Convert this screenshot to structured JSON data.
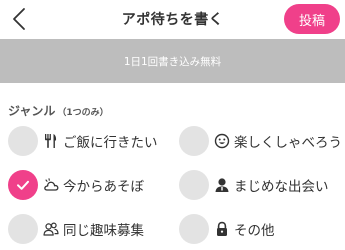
{
  "header": {
    "title": "アポ待ちを書く",
    "post_label": "投稿"
  },
  "banner": {
    "text": "1日1回書き込み無料"
  },
  "genre": {
    "title": "ジャンル",
    "note": "（1つのみ）",
    "options": [
      {
        "label": "ご飯に行きたい",
        "icon": "fork-knife-icon",
        "checked": false
      },
      {
        "label": "楽しくしゃべろう",
        "icon": "smiley-icon",
        "checked": false
      },
      {
        "label": "今からあそぼ",
        "icon": "cloud-icon",
        "checked": true
      },
      {
        "label": "まじめな出会い",
        "icon": "person-icon",
        "checked": false
      },
      {
        "label": "同じ趣味募集",
        "icon": "people-icon",
        "checked": false
      },
      {
        "label": "その他",
        "icon": "lock-icon",
        "checked": false
      }
    ]
  },
  "colors": {
    "accent": "#f0408a",
    "banner": "#bdbdbd",
    "radio_unchecked": "#e3e3e3"
  }
}
